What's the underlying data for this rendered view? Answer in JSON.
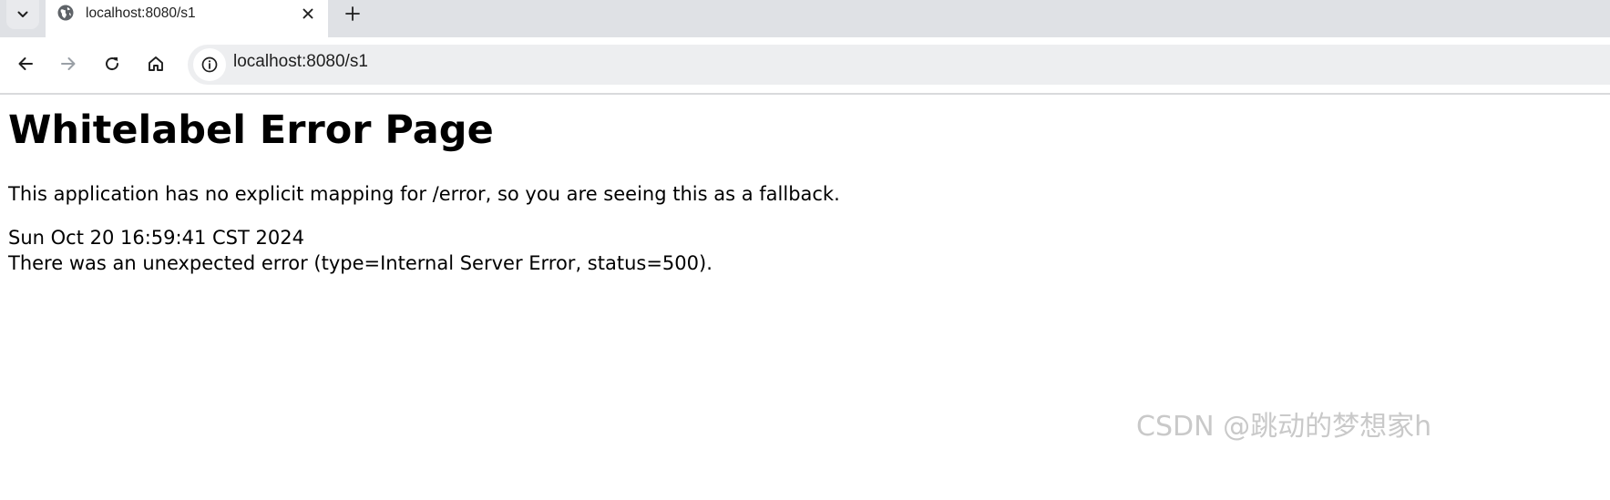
{
  "browser": {
    "tab": {
      "title": "localhost:8080/s1",
      "favicon": "globe-icon"
    },
    "address_bar": {
      "url": "localhost:8080/s1",
      "info_icon": "info-icon"
    },
    "icons": {
      "tab_menu": "chevron-down-icon",
      "tab_close": "close-icon",
      "new_tab": "plus-icon",
      "back": "arrow-left-icon",
      "forward": "arrow-right-icon",
      "reload": "reload-icon",
      "home": "home-icon"
    }
  },
  "page": {
    "heading": "Whitelabel Error Page",
    "fallback_message": "This application has no explicit mapping for /error, so you are seeing this as a fallback.",
    "timestamp": "Sun Oct 20 16:59:41 CST 2024",
    "error_detail": "There was an unexpected error (type=Internal Server Error, status=500)."
  },
  "watermark": "CSDN @跳动的梦想家h",
  "colors": {
    "tabstrip_bg": "#dfe1e5",
    "omnibox_bg": "#edeef0",
    "text": "#000000",
    "watermark": "#c9c9c9"
  }
}
